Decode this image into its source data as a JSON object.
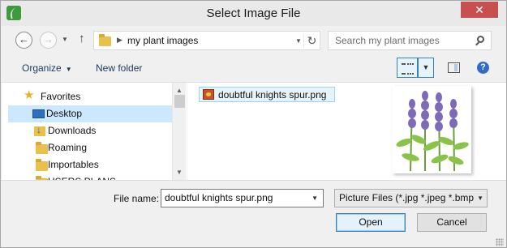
{
  "window": {
    "title": "Select Image File",
    "close_glyph": "✕"
  },
  "navigation": {
    "back_glyph": "←",
    "forward_glyph": "→",
    "up_glyph": "↑",
    "refresh_glyph": "↻"
  },
  "address": {
    "path": "my plant images"
  },
  "search": {
    "placeholder": "Search my plant images"
  },
  "toolbar": {
    "organize_label": "Organize",
    "new_folder_label": "New folder",
    "help_glyph": "?"
  },
  "sidebar": {
    "items": [
      {
        "label": "Favorites",
        "icon": "star-icon"
      },
      {
        "label": "Desktop",
        "icon": "desktop-icon",
        "selected": true
      },
      {
        "label": "Downloads",
        "icon": "downloads-icon"
      },
      {
        "label": "Roaming",
        "icon": "folder-icon"
      },
      {
        "label": "Importables",
        "icon": "folder-icon"
      },
      {
        "label": "USERS PLANS",
        "icon": "folder-icon"
      }
    ]
  },
  "files": {
    "items": [
      {
        "name": "doubtful knights spur.png",
        "selected": true
      }
    ]
  },
  "footer": {
    "file_name_label": "File name:",
    "file_name_value": "doubtful knights spur.png",
    "file_type_filter": "Picture Files (*.jpg *.jpeg *.bmp",
    "open_label": "Open",
    "cancel_label": "Cancel"
  },
  "colors": {
    "accent_selected": "#cce8ff",
    "close_button": "#c7504f",
    "focus_border": "#3c7fb1"
  }
}
